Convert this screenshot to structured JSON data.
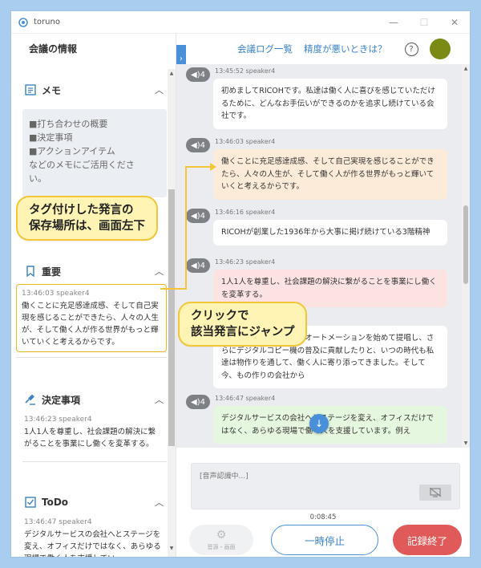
{
  "window": {
    "title": "toruno",
    "minimize": "—",
    "maximize": "☐",
    "close": "✕"
  },
  "sidebar": {
    "title": "会議の情報",
    "memo": {
      "label": "メモ",
      "lines": [
        "■打ち合わせの概要",
        "■決定事項",
        "■アクションアイテム",
        "などのメモにご活用くださ",
        "い。"
      ]
    },
    "important": {
      "label": "重要",
      "timestamp": "13:46:03 speaker4",
      "text": "働くことに充足感達成感、そして自己実現を感じることができたら、人々の人生が、そして働く人が作る世界がもっと輝いていくと考えるからです。"
    },
    "decisions": {
      "label": "決定事項",
      "timestamp": "13:46:23 speaker4",
      "text": "1人1人を尊重し、社会課題の解決に繋がることを事業にし働くを変革する。"
    },
    "todo": {
      "label": "ToDo",
      "timestamp": "13:46:47 speaker4",
      "text": "デジタルサービスの会社へとステージを変え、オフィスだけではなく、あらゆる現場で働く人を支援してい"
    }
  },
  "toolbar": {
    "log_link": "会議ログ一覧",
    "help_link": "精度が悪いときは？",
    "help_icon": "?"
  },
  "messages": [
    {
      "speaker": "4",
      "timestamp": "13:45:52 speaker4",
      "text": "初めましてRICOHです。私達は働く人に喜びを感じていただけるために、どんなお手伝いができるのかを追求し続けている会社です。",
      "tag": "none"
    },
    {
      "speaker": "4",
      "timestamp": "13:46:03 speaker4",
      "text": "働くことに充足感達成感、そして自己実現を感じることができたら、人々の人生が、そして働く人が作る世界がもっと輝いていくと考えるからです。",
      "tag": "important"
    },
    {
      "speaker": "4",
      "timestamp": "13:46:16 speaker4",
      "text": "RICOHが創業した1936年から大事に掲げ続けている3階精神",
      "tag": "none"
    },
    {
      "speaker": "4",
      "timestamp": "13:46:23 speaker4",
      "text": "1人1人を尊重し、社会課題の解決に繋がることを事業にし働くを変革する。",
      "tag": "decision"
    },
    {
      "speaker": "4",
      "timestamp": "",
      "text": "の時代ですが、オフィスオートメーションを始めて提唱し、さらにデジタルコピー機の普及に貢献したりと、いつの時代も私達は物作りを通して、働く人に寄り添ってきました。そして今、もの作りの会社から",
      "tag": "none"
    },
    {
      "speaker": "4",
      "timestamp": "13:46:47 speaker4",
      "text": "デジタルサービスの会社へとステージを変え、オフィスだけではなく、あらゆる現場で働く人を支援しています。例え",
      "tag": "todo"
    }
  ],
  "recognition": {
    "placeholder": "[音声認識中...]"
  },
  "timer": "0:08:45",
  "controls": {
    "audio_label": "音源・画面",
    "pause": "一時停止",
    "end": "記録終了"
  },
  "callouts": {
    "left": [
      "タグ付けした発言の",
      "保存場所は、画面左下"
    ],
    "right": [
      "クリックで",
      "該当発言にジャンプ"
    ]
  },
  "colors": {
    "accent": "#4a90d9",
    "highlight": "#f3c63a",
    "end_button": "#e05a5a",
    "avatar": "#7a8a14"
  }
}
